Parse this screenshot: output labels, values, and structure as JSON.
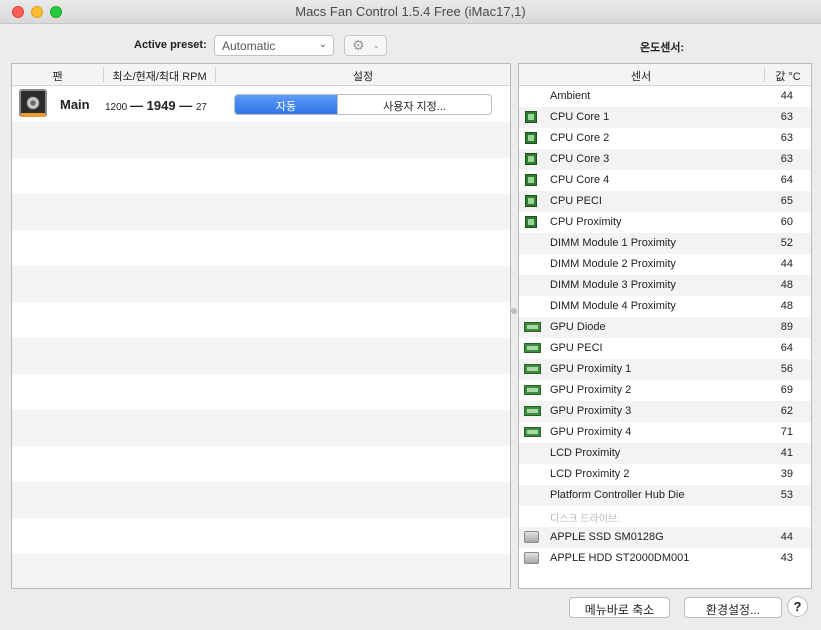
{
  "window": {
    "title": "Macs Fan Control 1.5.4 Free (iMac17,1)"
  },
  "toolbar": {
    "preset_label": "Active preset:",
    "preset_value": "Automatic",
    "gear_icon": "gear-icon"
  },
  "fans": {
    "columns": {
      "fan": "팬",
      "rpm": "최소/현재/최대 RPM",
      "settings": "설정"
    },
    "rows": [
      {
        "name": "Main",
        "min": "1200",
        "current": "1949",
        "max": "27",
        "auto_label": "자동",
        "custom_label": "사용자 지정..."
      }
    ]
  },
  "sensors": {
    "title": "온도센서:",
    "columns": {
      "sensor": "센서",
      "value": "값 °C"
    },
    "rows": [
      {
        "name": "Ambient",
        "value": "44",
        "icon": "none"
      },
      {
        "name": "CPU Core 1",
        "value": "63",
        "icon": "cpu"
      },
      {
        "name": "CPU Core 2",
        "value": "63",
        "icon": "cpu"
      },
      {
        "name": "CPU Core 3",
        "value": "63",
        "icon": "cpu"
      },
      {
        "name": "CPU Core 4",
        "value": "64",
        "icon": "cpu"
      },
      {
        "name": "CPU PECI",
        "value": "65",
        "icon": "cpu"
      },
      {
        "name": "CPU Proximity",
        "value": "60",
        "icon": "cpu"
      },
      {
        "name": "DIMM Module 1 Proximity",
        "value": "52",
        "icon": "none"
      },
      {
        "name": "DIMM Module 2 Proximity",
        "value": "44",
        "icon": "none"
      },
      {
        "name": "DIMM Module 3 Proximity",
        "value": "48",
        "icon": "none"
      },
      {
        "name": "DIMM Module 4 Proximity",
        "value": "48",
        "icon": "none"
      },
      {
        "name": "GPU Diode",
        "value": "89",
        "icon": "gpu"
      },
      {
        "name": "GPU PECI",
        "value": "64",
        "icon": "gpu"
      },
      {
        "name": "GPU Proximity 1",
        "value": "56",
        "icon": "gpu"
      },
      {
        "name": "GPU Proximity 2",
        "value": "69",
        "icon": "gpu"
      },
      {
        "name": "GPU Proximity 3",
        "value": "62",
        "icon": "gpu"
      },
      {
        "name": "GPU Proximity 4",
        "value": "71",
        "icon": "gpu"
      },
      {
        "name": "LCD Proximity",
        "value": "41",
        "icon": "none"
      },
      {
        "name": "LCD Proximity 2",
        "value": "39",
        "icon": "none"
      },
      {
        "name": "Platform Controller Hub Die",
        "value": "53",
        "icon": "none"
      },
      {
        "name": "디스크 드라이브:",
        "value": "",
        "icon": "group"
      },
      {
        "name": "APPLE SSD SM0128G",
        "value": "44",
        "icon": "disk"
      },
      {
        "name": "APPLE HDD ST2000DM001",
        "value": "43",
        "icon": "disk"
      }
    ]
  },
  "footer": {
    "menubar_label": "메뉴바로 축소",
    "prefs_label": "환경설정...",
    "help_label": "?"
  },
  "colors": {
    "accent": "#2f74ea",
    "cpu_icon": "#2f7c2f",
    "fan_tag": "#e99c2a"
  }
}
